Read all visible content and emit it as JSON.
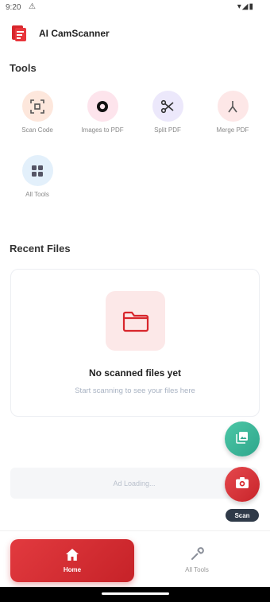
{
  "status_bar": {
    "time": "9:20",
    "warning_glyph": "⚠",
    "right_glyphs": "▾◢▮"
  },
  "app": {
    "title": "AI CamScanner",
    "accent": "#d8262c"
  },
  "tools_section": {
    "title": "Tools",
    "items": [
      {
        "label": "Scan Code",
        "icon": "scan-code-icon",
        "bg": "#fde7dc",
        "color": "#555"
      },
      {
        "label": "Images to PDF",
        "icon": "images-to-pdf-icon",
        "bg": "#fde4ec",
        "color": "#111"
      },
      {
        "label": "Split PDF",
        "icon": "scissors-icon",
        "bg": "#ece8fb",
        "color": "#333"
      },
      {
        "label": "Merge PDF",
        "icon": "merge-icon",
        "bg": "#fde7e7",
        "color": "#555"
      },
      {
        "label": "All Tools",
        "icon": "grid-icon",
        "bg": "#e3f0fb",
        "color": "#556"
      }
    ]
  },
  "recent_files": {
    "title": "Recent Files",
    "empty_title": "No scanned files yet",
    "empty_subtitle": "Start scanning to see your files here"
  },
  "ad": {
    "text": "Ad Loading..."
  },
  "fab": {
    "scan_label": "Scan"
  },
  "bottom_nav": {
    "home_label": "Home",
    "tools_label": "All Tools"
  }
}
